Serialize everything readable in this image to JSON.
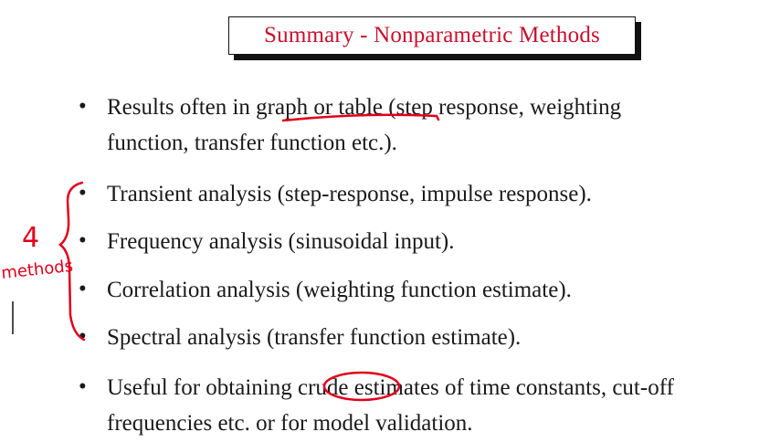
{
  "title": "Summary - Nonparametric Methods",
  "items": [
    {
      "lines": [
        "Results often in graph or table (step response, weighting",
        "function, transfer function etc.)."
      ]
    },
    {
      "lines": [
        "Transient analysis (step-response, impulse response)."
      ]
    },
    {
      "lines": [
        "Frequency analysis (sinusoidal input)."
      ]
    },
    {
      "lines": [
        "Correlation analysis (weighting function estimate)."
      ]
    },
    {
      "lines": [
        "Spectral analysis (transfer function estimate)."
      ]
    },
    {
      "lines": [
        "Useful for obtaining crude estimates of time constants, cut-off",
        "frequencies etc. or for model validation."
      ]
    }
  ],
  "annotation": {
    "number": "4",
    "word": "methods",
    "ink_color": "#e0001b"
  }
}
